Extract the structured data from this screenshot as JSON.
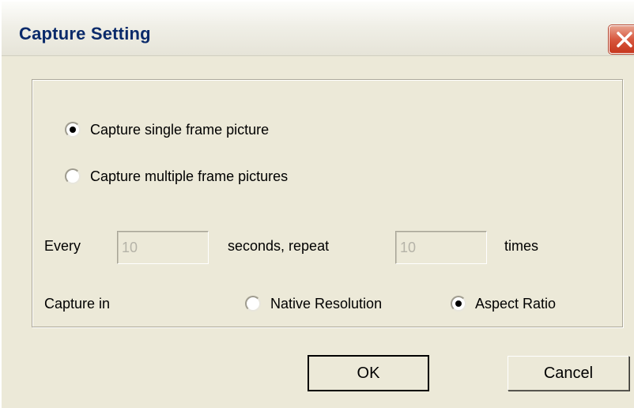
{
  "window": {
    "title": "Capture Setting"
  },
  "capture_mode": {
    "single_label": "Capture single frame picture",
    "multiple_label": "Capture multiple frame pictures",
    "selected": "single"
  },
  "interval": {
    "every_label": "Every",
    "seconds_value": "10",
    "seconds_label": "seconds, repeat",
    "times_value": "10",
    "times_label": "times"
  },
  "resolution": {
    "capture_in_label": "Capture in",
    "native_label": "Native Resolution",
    "aspect_label": "Aspect Ratio",
    "selected": "aspect"
  },
  "buttons": {
    "ok_label": "OK",
    "cancel_label": "Cancel"
  },
  "colors": {
    "dialog_bg": "#ece9d8",
    "title_text": "#0a2a6a",
    "close_button": "#d8583f"
  }
}
